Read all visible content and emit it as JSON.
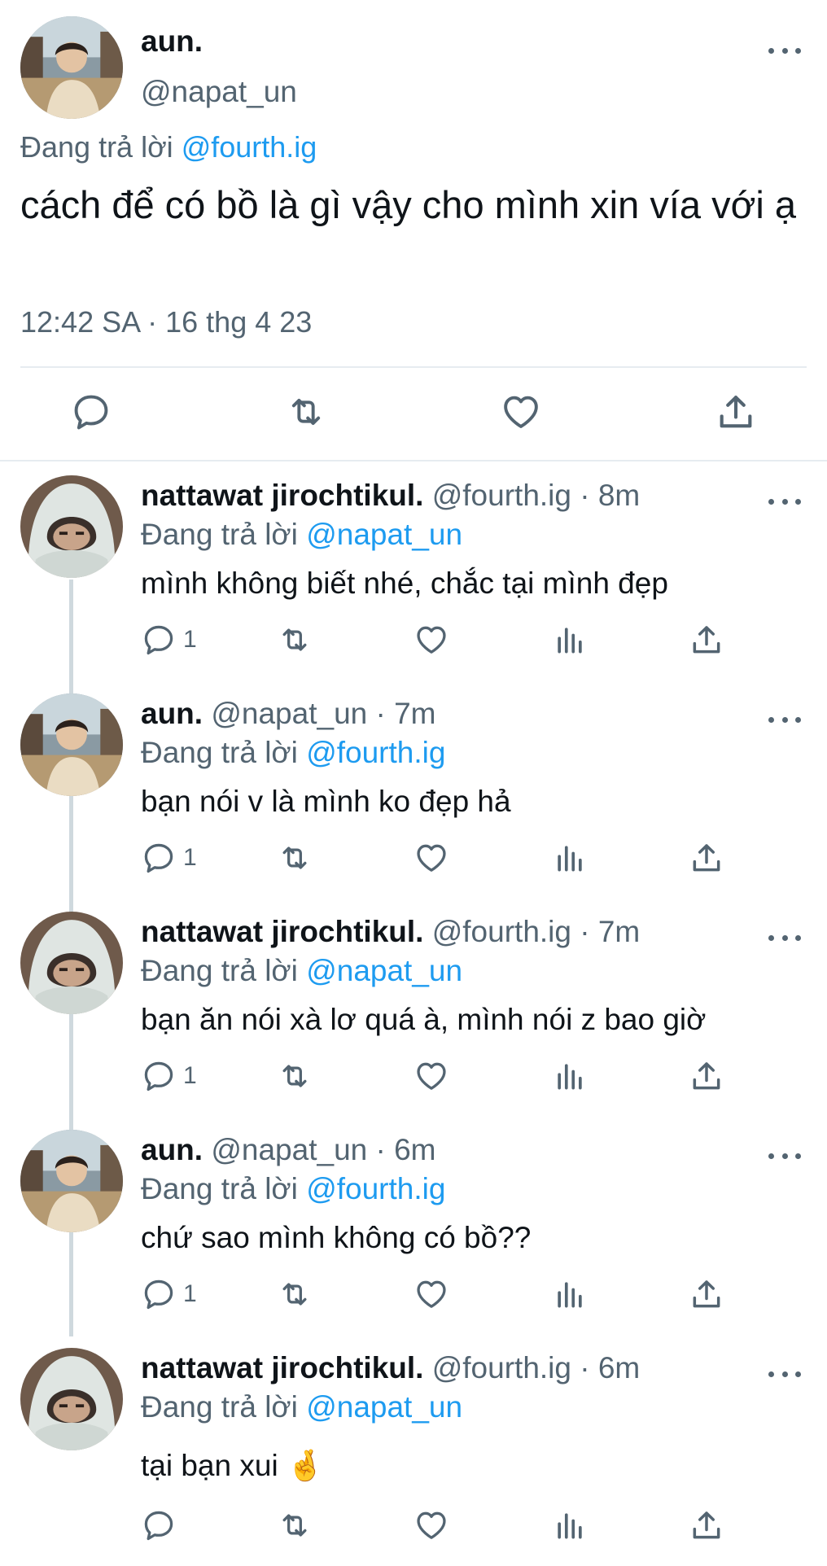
{
  "main_tweet": {
    "name": "aun.",
    "handle": "@napat_un",
    "reply_prefix": "Đang trả lời",
    "reply_to": "@fourth.ig",
    "text": "cách để có bồ là gì vậy cho mình xin vía với ạ",
    "timestamp": "12:42 SA · 16 thg 4 23",
    "avatar_icon": "user-photo-aun"
  },
  "replies": [
    {
      "name": "nattawat jirochtikul.",
      "handle_time": "@fourth.ig · 8m",
      "reply_prefix": "Đang trả lời",
      "reply_to": "@napat_un",
      "text": "mình không biết nhé, chắc tại mình đẹp",
      "reply_count": "1",
      "avatar_icon": "user-photo-fourth"
    },
    {
      "name": "aun.",
      "handle_time": "@napat_un · 7m",
      "reply_prefix": "Đang trả lời",
      "reply_to": "@fourth.ig",
      "text": "bạn nói v là mình ko đẹp hả",
      "reply_count": "1",
      "avatar_icon": "user-photo-aun"
    },
    {
      "name": "nattawat jirochtikul.",
      "handle_time": "@fourth.ig · 7m",
      "reply_prefix": "Đang trả lời",
      "reply_to": "@napat_un",
      "text": "bạn ăn nói xà lơ quá à, mình nói z bao giờ",
      "reply_count": "1",
      "avatar_icon": "user-photo-fourth"
    },
    {
      "name": "aun.",
      "handle_time": "@napat_un · 6m",
      "reply_prefix": "Đang trả lời",
      "reply_to": "@fourth.ig",
      "text": "chứ sao mình không có bồ??",
      "reply_count": "1",
      "avatar_icon": "user-photo-aun"
    },
    {
      "name": "nattawat jirochtikul.",
      "handle_time": "@fourth.ig · 6m",
      "reply_prefix": "Đang trả lời",
      "reply_to": "@napat_un",
      "text": "tại bạn xui",
      "emoji": "🤞",
      "reply_count": "",
      "avatar_icon": "user-photo-fourth"
    }
  ],
  "colors": {
    "text": "#0f1419",
    "secondary": "#536471",
    "link": "#1d9bf0",
    "divider": "#e6ecf0"
  }
}
